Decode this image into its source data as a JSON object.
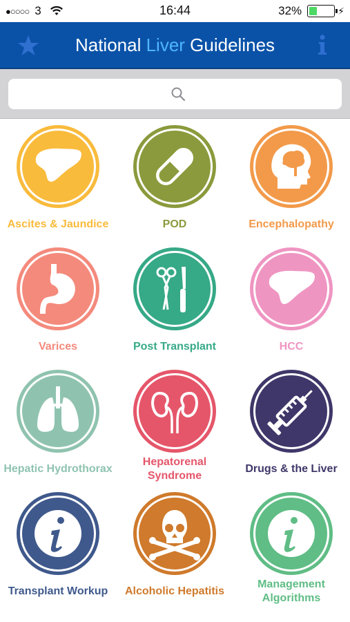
{
  "status_bar": {
    "signal_dots": "●○○○○",
    "carrier": "3",
    "time": "16:44",
    "battery_percent": "32%",
    "battery_level": 0.32,
    "icons": [
      "wifi-icon",
      "battery-icon",
      "charging-bolt-icon"
    ]
  },
  "nav": {
    "title_before": "National ",
    "title_accent": "Liver",
    "title_after": " Guidelines",
    "left_icon": "star-icon",
    "right_icon": "info-icon",
    "accent_color": "#4fb6ff",
    "bar_color": "#0a52a8"
  },
  "search": {
    "placeholder": "",
    "value": "",
    "icon": "search-icon"
  },
  "tiles": [
    {
      "label": "Ascites & Jaundice",
      "color": "#f9bb3c",
      "icon": "liver-icon"
    },
    {
      "label": "POD",
      "color": "#8b9a3c",
      "icon": "pill-icon"
    },
    {
      "label": "Encephalopathy",
      "color": "#f29a4a",
      "icon": "head-brain-icon"
    },
    {
      "label": "Varices",
      "color": "#f48a7c",
      "icon": "stomach-icon"
    },
    {
      "label": "Post Transplant",
      "color": "#36a987",
      "icon": "surgical-tools-icon"
    },
    {
      "label": "HCC",
      "color": "#ef95c2",
      "icon": "liver-icon"
    },
    {
      "label": "Hepatic Hydrothorax",
      "color": "#8fc3b0",
      "icon": "lungs-icon"
    },
    {
      "label": "Hepatorenal Syndrome",
      "color": "#e5566a",
      "icon": "kidneys-icon"
    },
    {
      "label": "Drugs & the Liver",
      "color": "#3f3769",
      "icon": "syringe-icon"
    },
    {
      "label": "Transplant Workup",
      "color": "#3f598c",
      "icon": "info-icon"
    },
    {
      "label": "Alcoholic Hepatitis",
      "color": "#cf7a2c",
      "icon": "skull-crossbones-icon"
    },
    {
      "label": "Management Algorithms",
      "color": "#5fbd85",
      "icon": "info-icon"
    }
  ]
}
